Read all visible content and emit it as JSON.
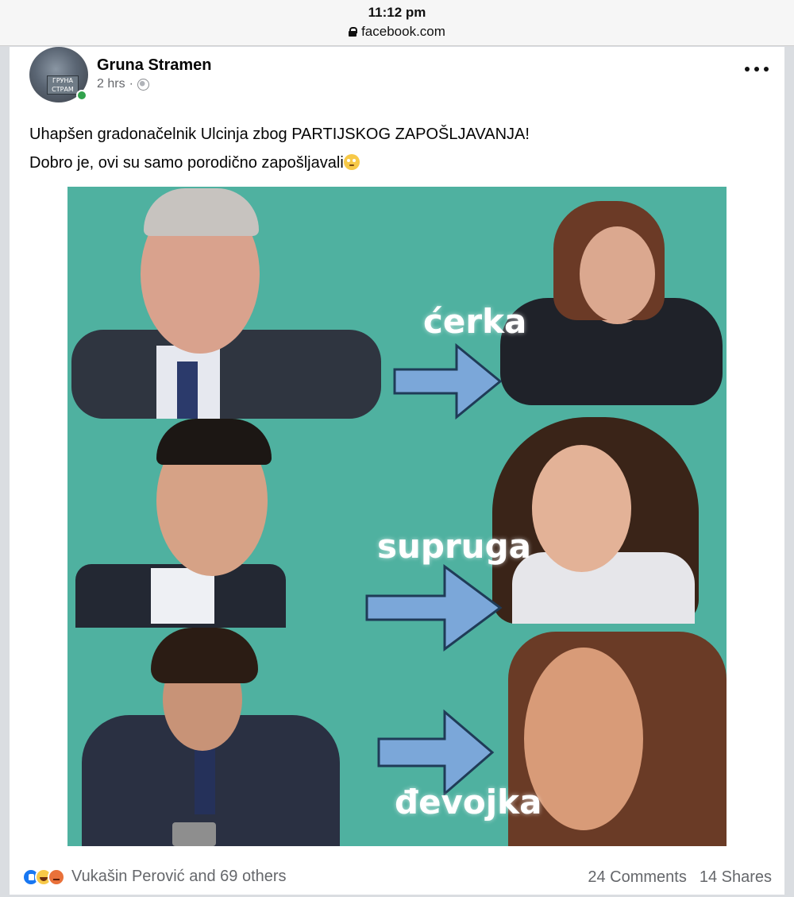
{
  "browser": {
    "time": "11:12 pm",
    "url": "facebook.com"
  },
  "post": {
    "author": "Gruna Stramen",
    "time_ago": "2 hrs",
    "separator": "·",
    "avatar_sign_text": "ГРУНА СТРАМ",
    "lines": [
      "Uhapšen gradonačelnik Ulcinja zbog PARTIJSKOG ZAPOŠLJAVANJA!",
      "Dobro je, ovi su samo porodično zapošljavali"
    ],
    "image": {
      "background_color": "#4fb1a0",
      "arrow_color": "#7ba7d9",
      "labels": [
        "ćerka",
        "supruga",
        "đevojka"
      ]
    }
  },
  "footer": {
    "reactions": [
      "like-icon",
      "haha-icon",
      "angry-icon"
    ],
    "reaction_text": "Vukašin Perović and 69 others",
    "comments": "24 Comments",
    "shares": "14 Shares"
  }
}
